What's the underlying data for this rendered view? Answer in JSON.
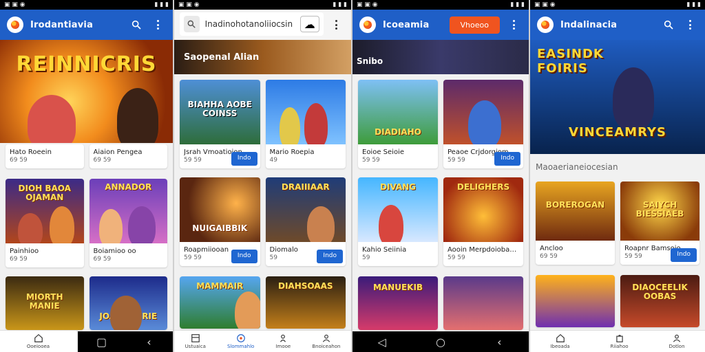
{
  "colors": {
    "primary": "#1f5fc7",
    "button_blue": "#1f66d1",
    "orange": "#f0541f",
    "bg": "#f1f1f1"
  },
  "panel1": {
    "app_title": "Irodantiavia",
    "hero_title": "REINNICRIS",
    "cards": [
      {
        "name": "Hato Roeein",
        "sub": "69 59"
      },
      {
        "name": "Aiaion Pengea",
        "sub": "69 59"
      },
      {
        "name": "Painhioo",
        "sub": "69 59"
      },
      {
        "name": "Boiamioo oo",
        "sub": "69 59"
      }
    ],
    "thumbs": [
      "",
      "",
      "DIOH BAOA OJAMAN",
      "ANNADOR",
      "MIORTH MANIE",
      "JOAT BISIRIE"
    ]
  },
  "panel2": {
    "search_placeholder": "Inadinohotanoliiocsin",
    "section_label": "Saopenal Alian",
    "cards": [
      {
        "name": "Jsrah Vmoatioion",
        "sub": "59 59",
        "thumb": "BIAHHA AOBE COINSS",
        "button": "Indo"
      },
      {
        "name": "Mario Roepia",
        "sub": "49",
        "thumb": "",
        "button": ""
      },
      {
        "name": "Roapmiiooan",
        "sub": "59 59",
        "thumb": "NUIGAIBBIK",
        "button": "Indo"
      },
      {
        "name": "Diomalo",
        "sub": "59",
        "thumb": "DRAIIIAAR",
        "button": "Indo"
      }
    ],
    "thumbs_bottom": [
      "MAMMAIR",
      "DIAHSOAAS"
    ],
    "nav": [
      {
        "label": "Ustuaica",
        "icon": "grid-icon"
      },
      {
        "label": "Slommahlo",
        "icon": "compass-icon"
      },
      {
        "label": "Imooe",
        "icon": "person-icon"
      },
      {
        "label": "Bnoiceahon",
        "icon": "user-icon"
      }
    ]
  },
  "panel3": {
    "app_title": "Icoeamia",
    "action_button": "Vhoeoo",
    "section_label": "Snibo",
    "cards": [
      {
        "name": "Eoioe Seioie",
        "sub": "59 59",
        "thumb": "DIADIAHO",
        "button": ""
      },
      {
        "name": "Peaoe Crjdorgiom",
        "sub": "59 59",
        "thumb": "",
        "button": "Indo"
      },
      {
        "name": "Kahio Seiinia",
        "sub": "59",
        "thumb": "DIVANG",
        "button": ""
      },
      {
        "name": "Aooin Merpdoiobaoden",
        "sub": "59 59",
        "thumb": "DELIGHERS",
        "button": ""
      }
    ],
    "thumbs_bottom": [
      "MANUEKIB",
      ""
    ]
  },
  "panel4": {
    "app_title": "Indalinacia",
    "hero_title_top": "EASINDK FOIRIS",
    "hero_title_bottom": "VINCEAMRYS",
    "section_label": "Maoaerianeiocesian",
    "cards": [
      {
        "name": "Ancloo",
        "sub": "69 59",
        "thumb": "BOREROGAN",
        "button": ""
      },
      {
        "name": "Roapnr Bamsoio",
        "sub": "59 59",
        "thumb": "SAIYCH BIESSIAEB",
        "button": "Indo"
      }
    ],
    "thumbs_bottom": [
      "",
      "DIAOCEELIK OOBAS"
    ],
    "nav": [
      {
        "label": "Ibeoada",
        "icon": "home-icon"
      },
      {
        "label": "Riiahoo",
        "icon": "bag-icon"
      },
      {
        "label": "Dotlon",
        "icon": "user-icon"
      }
    ]
  },
  "panel1_nav": [
    {
      "label": "Ooeiooea",
      "icon": "home-icon"
    }
  ]
}
